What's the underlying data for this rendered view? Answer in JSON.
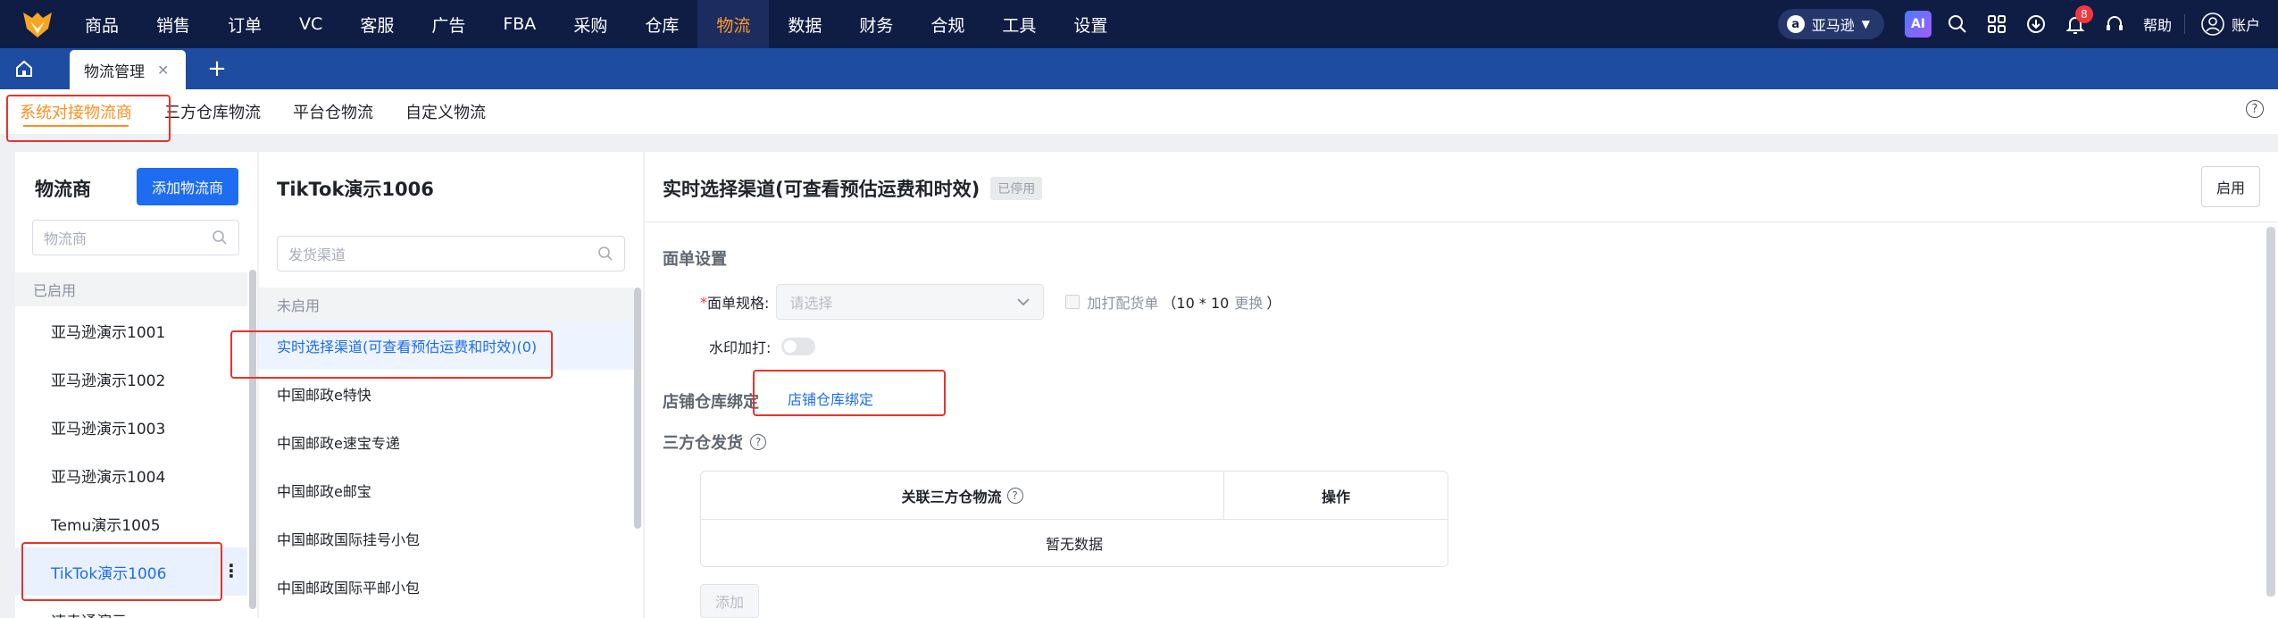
{
  "topnav": {
    "items": [
      "商品",
      "销售",
      "订单",
      "VC",
      "客服",
      "广告",
      "FBA",
      "采购",
      "仓库",
      "物流",
      "数据",
      "财务",
      "合规",
      "工具",
      "设置"
    ],
    "active_index": 9,
    "store_label": "亚马逊",
    "ai_label": "AI",
    "notification_count": "8",
    "help_label": "帮助",
    "account_label": "账户"
  },
  "tabbar": {
    "page_tab_label": "物流管理",
    "close_glyph": "✕",
    "add_glyph": "+"
  },
  "subtabs": [
    "系统对接物流商",
    "三方仓库物流",
    "平台仓物流",
    "自定义物流"
  ],
  "subtab_help": "?",
  "carriers": {
    "title": "物流商",
    "add_button": "添加物流商",
    "search_placeholder": "物流商",
    "group_label": "已启用",
    "items": [
      "亚马逊演示1001",
      "亚马逊演示1002",
      "亚马逊演示1003",
      "亚马逊演示1004",
      "Temu演示1005",
      "TikTok演示1006",
      "速卖通演示"
    ]
  },
  "channels": {
    "title": "TikTok演示1006",
    "search_placeholder": "发货渠道",
    "group_label": "未启用",
    "items": [
      "实时选择渠道(可查看预估运费和时效)(0)",
      "中国邮政e特快",
      "中国邮政e速宝专递",
      "中国邮政e邮宝",
      "中国邮政国际挂号小包",
      "中国邮政国际平邮小包"
    ]
  },
  "detail": {
    "title": "实时选择渠道(可查看预估运费和时效)",
    "status": "已停用",
    "enable_button": "启用",
    "section_label_settings": "面单设置",
    "label_spec": "面单规格:",
    "required_mark": "*",
    "select_placeholder": "请选择",
    "extra_print_label": "加打配货单",
    "extra_print_size": "（10 * 10",
    "extra_print_change": "更换",
    "extra_print_close": "）",
    "watermark_label": "水印加打:",
    "section_label_store": "店铺仓库绑定",
    "store_link": "店铺仓库绑定",
    "section_label_3pl": "三方仓发货",
    "table_col_1": "关联三方仓物流",
    "table_col_2": "操作",
    "table_empty": "暂无数据",
    "add_button": "添加"
  }
}
